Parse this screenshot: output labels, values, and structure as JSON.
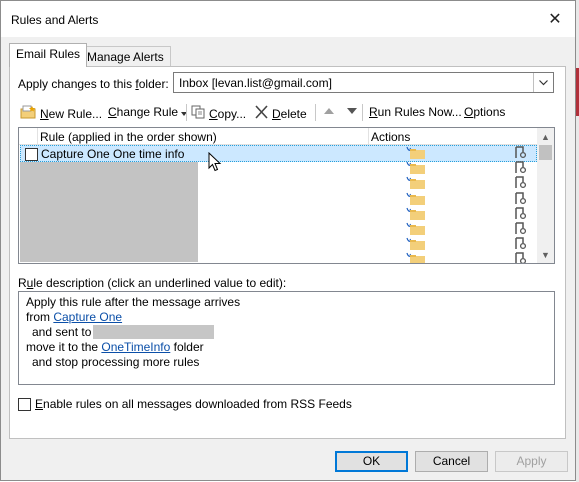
{
  "window": {
    "title": "Rules and Alerts"
  },
  "tabs": [
    {
      "label": "Email Rules",
      "active": true
    },
    {
      "label": "Manage Alerts",
      "active": false
    }
  ],
  "folder": {
    "label_prefix": "Apply changes to this ",
    "label_underlined": "f",
    "label_suffix": "older:",
    "value": "Inbox [levan.list@gmail.com]"
  },
  "toolbar": {
    "new_rule": {
      "u": "N",
      "rest": "ew Rule..."
    },
    "change_rule": {
      "u": "C",
      "rest": "hange Rule"
    },
    "copy": {
      "u": "C",
      "rest": "opy..."
    },
    "delete": {
      "u": "D",
      "rest": "elete"
    },
    "run_rules": {
      "u": "R",
      "rest": "un Rules Now..."
    },
    "options": {
      "u": "O",
      "rest": "ptions"
    }
  },
  "grid": {
    "col_rule": "Rule (applied in the order shown)",
    "col_actions": "Actions",
    "rows": [
      {
        "name": "Capture One One time info",
        "checked": false,
        "selected": true
      }
    ]
  },
  "description": {
    "label_prefix": "R",
    "label_underlined": "u",
    "label_suffix": "le description (click an underlined value to edit):",
    "line1": "Apply this rule after the message arrives",
    "line2_prefix": "from ",
    "line2_link": "Capture One",
    "line3_prefix": "and sent to",
    "line4_prefix": "move it to the ",
    "line4_link": "OneTimeInfo",
    "line4_suffix": " folder",
    "line5": "and stop processing more rules"
  },
  "rss": {
    "label_u": "E",
    "label_rest": "nable rules on all messages downloaded from RSS Feeds",
    "checked": false
  },
  "buttons": {
    "ok": "OK",
    "cancel": "Cancel",
    "apply": "Apply"
  },
  "colors": {
    "selection": "#cce8ff",
    "link": "#0b4fa8",
    "default_button": "#0078d7"
  }
}
